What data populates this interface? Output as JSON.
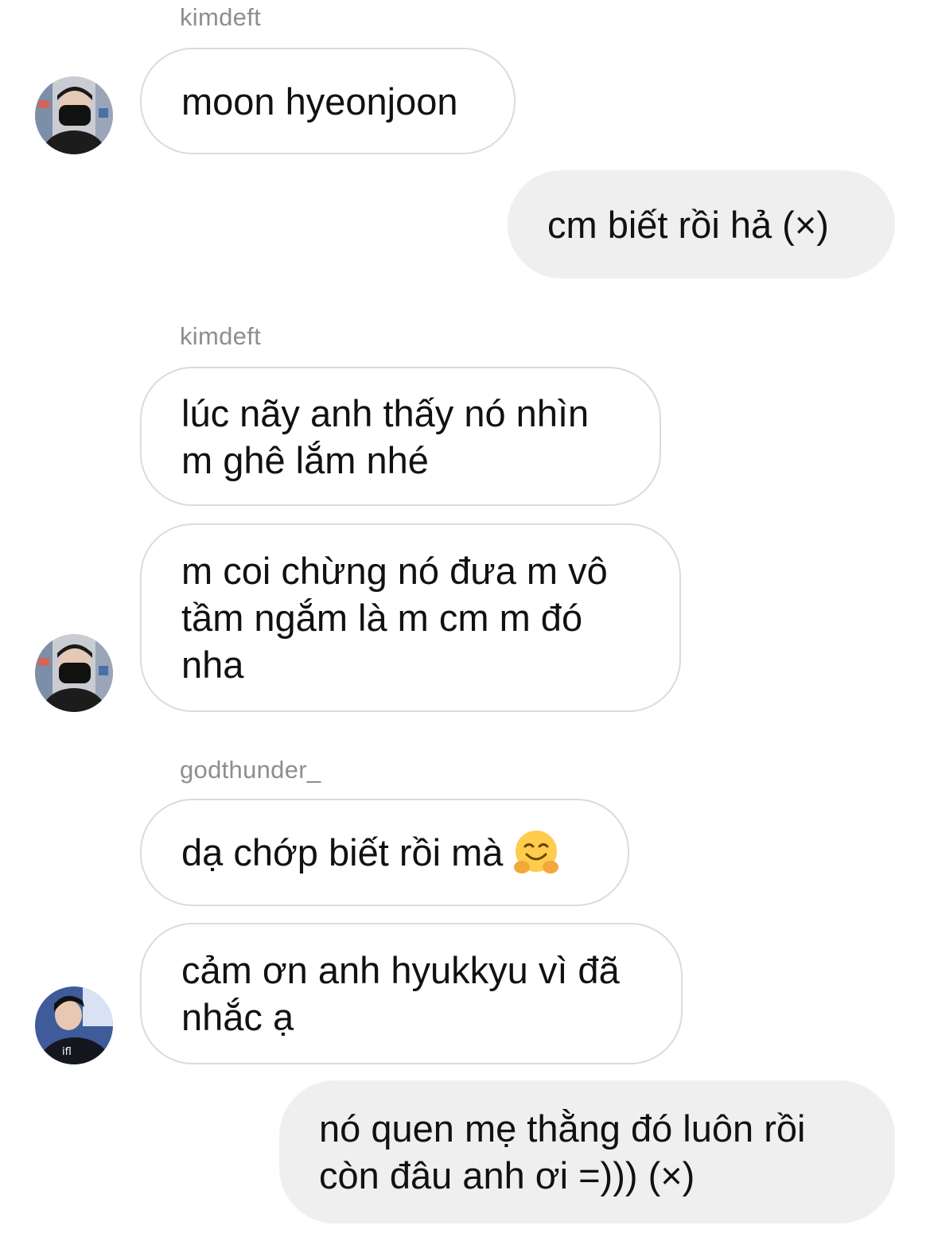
{
  "messages": [
    {
      "sender": "kimdeft",
      "text": "moon hyeonjoon"
    },
    {
      "text": "cm biết rồi hả (×)"
    },
    {
      "sender": "kimdeft",
      "text": "lúc nãy anh thấy nó nhìn\nm ghê lắm nhé"
    },
    {
      "text": "m coi chừng nó đưa m vô\ntầm ngắm là m cm m đó\nnha"
    },
    {
      "sender": "godthunder_",
      "text": "dạ chớp biết rồi mà"
    },
    {
      "text": "cảm ơn anh hyukkyu vì đã\nnhắc ạ"
    },
    {
      "text": "nó quen mẹ thằng đó luôn rồi\ncòn đâu anh ơi =))) (×)"
    }
  ],
  "icons": {
    "avatar_kimdeft": "avatar-photo-masked-person",
    "avatar_godthunder": "avatar-photo-player-jersey",
    "emoji": "hugging-face-emoji"
  },
  "colors": {
    "sender_name": "#8e8e8e",
    "incoming_border": "#dbdbdb",
    "outgoing_bg": "#efefef"
  }
}
